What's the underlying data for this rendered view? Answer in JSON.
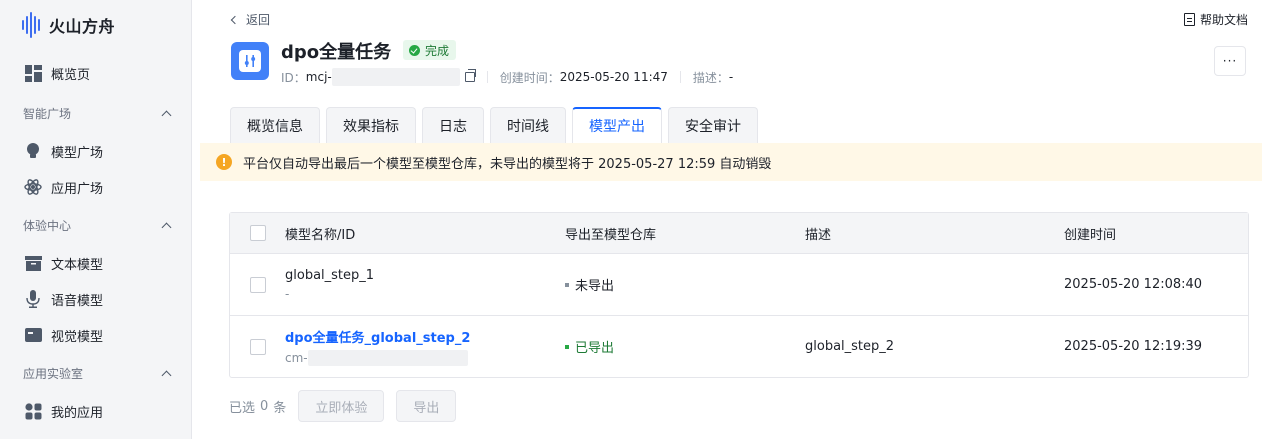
{
  "sidebar": {
    "logo_text": "火山方舟",
    "items": [
      {
        "label": "概览页"
      },
      {
        "group": "智能广场"
      },
      {
        "label": "模型广场"
      },
      {
        "label": "应用广场"
      },
      {
        "group": "体验中心"
      },
      {
        "label": "文本模型"
      },
      {
        "label": "语音模型"
      },
      {
        "label": "视觉模型"
      },
      {
        "group": "应用实验室"
      },
      {
        "label": "我的应用"
      }
    ]
  },
  "header": {
    "back_label": "返回",
    "help_label": "帮助文档",
    "more_label": "···",
    "title": "dpo全量任务",
    "status": "完成",
    "id_label": "ID：",
    "id_value": "mcj-",
    "created_label": "创建时间：",
    "created_value": "2025-05-20 11:47",
    "desc_label": "描述：",
    "desc_value": "-"
  },
  "tabs": [
    "概览信息",
    "效果指标",
    "日志",
    "时间线",
    "模型产出",
    "安全审计"
  ],
  "active_tab": "模型产出",
  "alert": {
    "icon": "!",
    "text": "平台仅自动导出最后一个模型至模型仓库，未导出的模型将于 2025-05-27 12:59 自动销毁"
  },
  "table": {
    "columns": [
      "模型名称/ID",
      "导出至模型仓库",
      "描述",
      "创建时间"
    ],
    "rows": [
      {
        "name": "global_step_1",
        "id": "-",
        "export": "未导出",
        "desc": "",
        "created": "2025-05-20 12:08:40"
      },
      {
        "name": "dpo全量任务_global_step_2",
        "id": "cm-",
        "export": "已导出",
        "desc": "global_step_2",
        "created": "2025-05-20 12:19:39"
      }
    ]
  },
  "footer": {
    "selected_prefix": "已选",
    "selected_count": "0",
    "selected_suffix": "条",
    "try_button": "立即体验",
    "export_button": "导出"
  },
  "colors": {
    "accent": "#1664ff",
    "success": "#27a845",
    "warning": "#f5a623",
    "not_exported": "#86909c"
  }
}
